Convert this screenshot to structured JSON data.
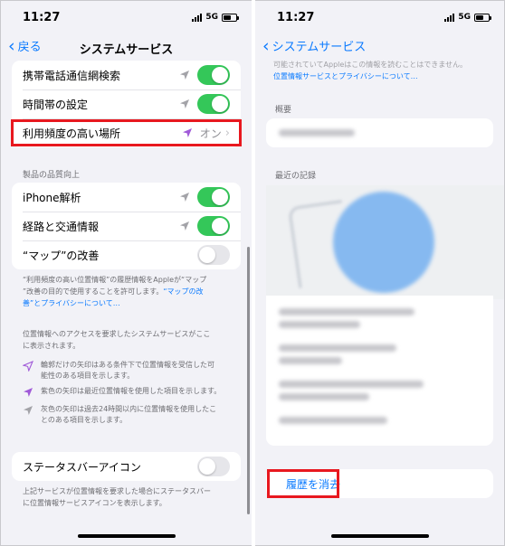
{
  "status_bar": {
    "time": "11:27",
    "network": "5G"
  },
  "left": {
    "nav": {
      "back_label": "戻る",
      "title": "システムサービス"
    },
    "rows_top": [
      {
        "label": "携帯電話通信網検索",
        "icon": "location-arrow-gray",
        "toggle": "on"
      },
      {
        "label": "時間帯の設定",
        "icon": "location-arrow-gray",
        "toggle": "on"
      },
      {
        "label": "利用頻度の高い場所",
        "icon": "location-arrow-purple",
        "value": "オン"
      }
    ],
    "section_header": "製品の品質向上",
    "rows_quality": [
      {
        "label": "iPhone解析",
        "icon": "location-arrow-gray",
        "toggle": "on"
      },
      {
        "label": "経路と交通情報",
        "icon": "location-arrow-gray",
        "toggle": "on"
      },
      {
        "label": "“マップ”の改善",
        "toggle": "off"
      }
    ],
    "footnote_line1": "“利用頻度の高い位置情報”の履歴情報をAppleが“マップ",
    "footnote_line2_pre": "”改善の目的で使用することを許可します。",
    "footnote_line2_link": "“マップの改",
    "footnote_line3_link": "善”とプライバシーについて…",
    "info_line1": "位置情報へのアクセスを要求したシステムサービスがここ",
    "info_line2": "に表示されます。",
    "legend": [
      {
        "icon": "location-arrow-outline",
        "line1": "輪郭だけの矢印はある条件下で位置情報を受信した可",
        "line2": "能性のある項目を示します。"
      },
      {
        "icon": "location-arrow-purple",
        "line1": "紫色の矢印は最近位置情報を使用した項目を示します。",
        "line2": ""
      },
      {
        "icon": "location-arrow-gray",
        "line1": "灰色の矢印は過去24時間以内に位置情報を使用したこ",
        "line2": "とのある項目を示します。"
      }
    ],
    "statusbar_row": {
      "label": "ステータスバーアイコン",
      "toggle": "off"
    },
    "bottom_note_line1": "上記サービスが位置情報を要求した場合にステータスバー",
    "bottom_note_line2": "に位置情報サービスアイコンを表示します。"
  },
  "right": {
    "nav": {
      "back_label": "システムサービス"
    },
    "top_text": "可能されていてAppleはこの情報を読むことはできません。",
    "top_link": "位置情報サービスとプライバシーについて…",
    "summary_header": "概要",
    "recent_header": "最近の記録",
    "clear_history": "履歴を消去"
  },
  "colors": {
    "accent": "#0a7aff",
    "toggle_on": "#34c759",
    "highlight": "#e8181f",
    "purple_arrow": "#a05ad8",
    "gray_arrow": "#8e8e93"
  }
}
